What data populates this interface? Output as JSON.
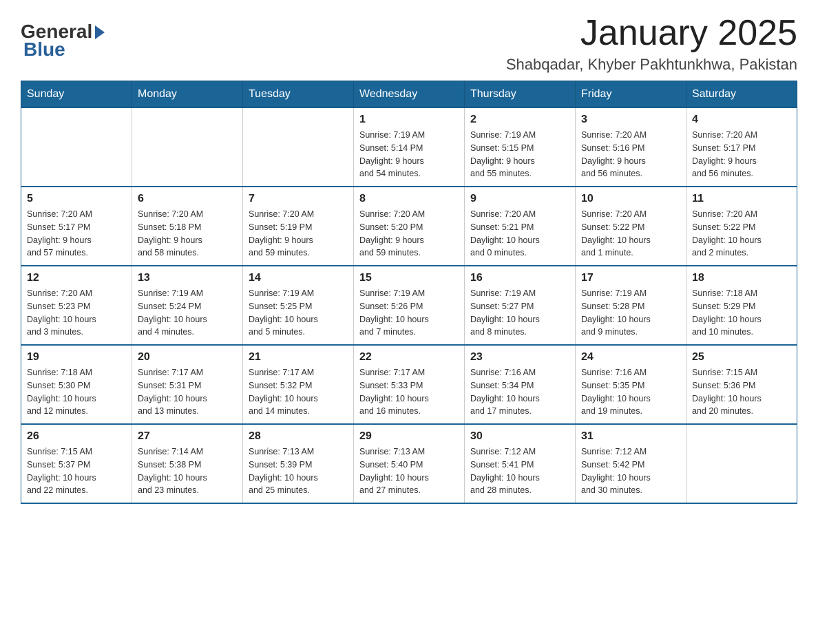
{
  "logo": {
    "text_general": "General",
    "text_blue": "Blue"
  },
  "title": "January 2025",
  "location": "Shabqadar, Khyber Pakhtunkhwa, Pakistan",
  "days_of_week": [
    "Sunday",
    "Monday",
    "Tuesday",
    "Wednesday",
    "Thursday",
    "Friday",
    "Saturday"
  ],
  "weeks": [
    [
      {
        "day": "",
        "info": ""
      },
      {
        "day": "",
        "info": ""
      },
      {
        "day": "",
        "info": ""
      },
      {
        "day": "1",
        "info": "Sunrise: 7:19 AM\nSunset: 5:14 PM\nDaylight: 9 hours\nand 54 minutes."
      },
      {
        "day": "2",
        "info": "Sunrise: 7:19 AM\nSunset: 5:15 PM\nDaylight: 9 hours\nand 55 minutes."
      },
      {
        "day": "3",
        "info": "Sunrise: 7:20 AM\nSunset: 5:16 PM\nDaylight: 9 hours\nand 56 minutes."
      },
      {
        "day": "4",
        "info": "Sunrise: 7:20 AM\nSunset: 5:17 PM\nDaylight: 9 hours\nand 56 minutes."
      }
    ],
    [
      {
        "day": "5",
        "info": "Sunrise: 7:20 AM\nSunset: 5:17 PM\nDaylight: 9 hours\nand 57 minutes."
      },
      {
        "day": "6",
        "info": "Sunrise: 7:20 AM\nSunset: 5:18 PM\nDaylight: 9 hours\nand 58 minutes."
      },
      {
        "day": "7",
        "info": "Sunrise: 7:20 AM\nSunset: 5:19 PM\nDaylight: 9 hours\nand 59 minutes."
      },
      {
        "day": "8",
        "info": "Sunrise: 7:20 AM\nSunset: 5:20 PM\nDaylight: 9 hours\nand 59 minutes."
      },
      {
        "day": "9",
        "info": "Sunrise: 7:20 AM\nSunset: 5:21 PM\nDaylight: 10 hours\nand 0 minutes."
      },
      {
        "day": "10",
        "info": "Sunrise: 7:20 AM\nSunset: 5:22 PM\nDaylight: 10 hours\nand 1 minute."
      },
      {
        "day": "11",
        "info": "Sunrise: 7:20 AM\nSunset: 5:22 PM\nDaylight: 10 hours\nand 2 minutes."
      }
    ],
    [
      {
        "day": "12",
        "info": "Sunrise: 7:20 AM\nSunset: 5:23 PM\nDaylight: 10 hours\nand 3 minutes."
      },
      {
        "day": "13",
        "info": "Sunrise: 7:19 AM\nSunset: 5:24 PM\nDaylight: 10 hours\nand 4 minutes."
      },
      {
        "day": "14",
        "info": "Sunrise: 7:19 AM\nSunset: 5:25 PM\nDaylight: 10 hours\nand 5 minutes."
      },
      {
        "day": "15",
        "info": "Sunrise: 7:19 AM\nSunset: 5:26 PM\nDaylight: 10 hours\nand 7 minutes."
      },
      {
        "day": "16",
        "info": "Sunrise: 7:19 AM\nSunset: 5:27 PM\nDaylight: 10 hours\nand 8 minutes."
      },
      {
        "day": "17",
        "info": "Sunrise: 7:19 AM\nSunset: 5:28 PM\nDaylight: 10 hours\nand 9 minutes."
      },
      {
        "day": "18",
        "info": "Sunrise: 7:18 AM\nSunset: 5:29 PM\nDaylight: 10 hours\nand 10 minutes."
      }
    ],
    [
      {
        "day": "19",
        "info": "Sunrise: 7:18 AM\nSunset: 5:30 PM\nDaylight: 10 hours\nand 12 minutes."
      },
      {
        "day": "20",
        "info": "Sunrise: 7:17 AM\nSunset: 5:31 PM\nDaylight: 10 hours\nand 13 minutes."
      },
      {
        "day": "21",
        "info": "Sunrise: 7:17 AM\nSunset: 5:32 PM\nDaylight: 10 hours\nand 14 minutes."
      },
      {
        "day": "22",
        "info": "Sunrise: 7:17 AM\nSunset: 5:33 PM\nDaylight: 10 hours\nand 16 minutes."
      },
      {
        "day": "23",
        "info": "Sunrise: 7:16 AM\nSunset: 5:34 PM\nDaylight: 10 hours\nand 17 minutes."
      },
      {
        "day": "24",
        "info": "Sunrise: 7:16 AM\nSunset: 5:35 PM\nDaylight: 10 hours\nand 19 minutes."
      },
      {
        "day": "25",
        "info": "Sunrise: 7:15 AM\nSunset: 5:36 PM\nDaylight: 10 hours\nand 20 minutes."
      }
    ],
    [
      {
        "day": "26",
        "info": "Sunrise: 7:15 AM\nSunset: 5:37 PM\nDaylight: 10 hours\nand 22 minutes."
      },
      {
        "day": "27",
        "info": "Sunrise: 7:14 AM\nSunset: 5:38 PM\nDaylight: 10 hours\nand 23 minutes."
      },
      {
        "day": "28",
        "info": "Sunrise: 7:13 AM\nSunset: 5:39 PM\nDaylight: 10 hours\nand 25 minutes."
      },
      {
        "day": "29",
        "info": "Sunrise: 7:13 AM\nSunset: 5:40 PM\nDaylight: 10 hours\nand 27 minutes."
      },
      {
        "day": "30",
        "info": "Sunrise: 7:12 AM\nSunset: 5:41 PM\nDaylight: 10 hours\nand 28 minutes."
      },
      {
        "day": "31",
        "info": "Sunrise: 7:12 AM\nSunset: 5:42 PM\nDaylight: 10 hours\nand 30 minutes."
      },
      {
        "day": "",
        "info": ""
      }
    ]
  ]
}
